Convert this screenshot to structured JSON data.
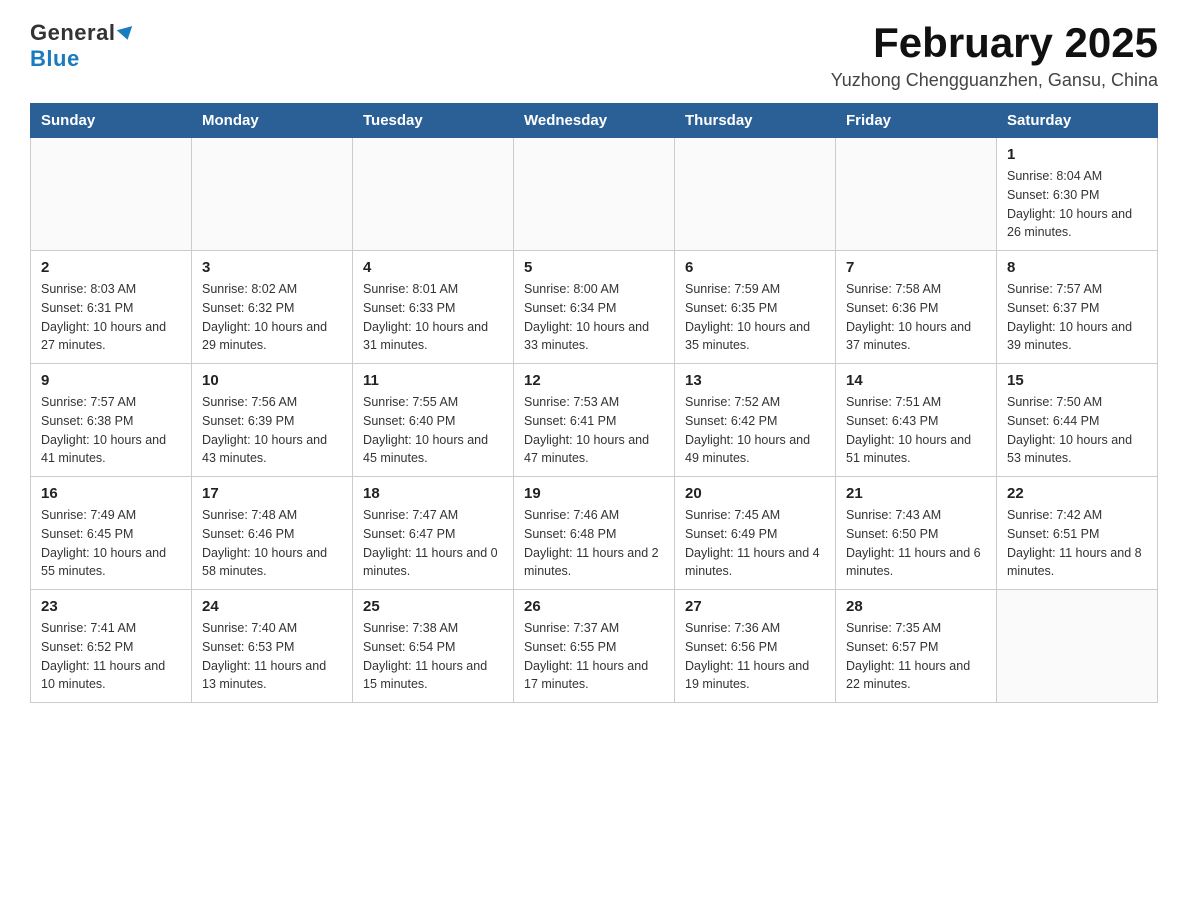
{
  "header": {
    "logo_general": "General",
    "logo_blue": "Blue",
    "month_title": "February 2025",
    "location": "Yuzhong Chengguanzhen, Gansu, China"
  },
  "weekdays": [
    "Sunday",
    "Monday",
    "Tuesday",
    "Wednesday",
    "Thursday",
    "Friday",
    "Saturday"
  ],
  "weeks": [
    [
      {
        "day": "",
        "info": ""
      },
      {
        "day": "",
        "info": ""
      },
      {
        "day": "",
        "info": ""
      },
      {
        "day": "",
        "info": ""
      },
      {
        "day": "",
        "info": ""
      },
      {
        "day": "",
        "info": ""
      },
      {
        "day": "1",
        "info": "Sunrise: 8:04 AM\nSunset: 6:30 PM\nDaylight: 10 hours and 26 minutes."
      }
    ],
    [
      {
        "day": "2",
        "info": "Sunrise: 8:03 AM\nSunset: 6:31 PM\nDaylight: 10 hours and 27 minutes."
      },
      {
        "day": "3",
        "info": "Sunrise: 8:02 AM\nSunset: 6:32 PM\nDaylight: 10 hours and 29 minutes."
      },
      {
        "day": "4",
        "info": "Sunrise: 8:01 AM\nSunset: 6:33 PM\nDaylight: 10 hours and 31 minutes."
      },
      {
        "day": "5",
        "info": "Sunrise: 8:00 AM\nSunset: 6:34 PM\nDaylight: 10 hours and 33 minutes."
      },
      {
        "day": "6",
        "info": "Sunrise: 7:59 AM\nSunset: 6:35 PM\nDaylight: 10 hours and 35 minutes."
      },
      {
        "day": "7",
        "info": "Sunrise: 7:58 AM\nSunset: 6:36 PM\nDaylight: 10 hours and 37 minutes."
      },
      {
        "day": "8",
        "info": "Sunrise: 7:57 AM\nSunset: 6:37 PM\nDaylight: 10 hours and 39 minutes."
      }
    ],
    [
      {
        "day": "9",
        "info": "Sunrise: 7:57 AM\nSunset: 6:38 PM\nDaylight: 10 hours and 41 minutes."
      },
      {
        "day": "10",
        "info": "Sunrise: 7:56 AM\nSunset: 6:39 PM\nDaylight: 10 hours and 43 minutes."
      },
      {
        "day": "11",
        "info": "Sunrise: 7:55 AM\nSunset: 6:40 PM\nDaylight: 10 hours and 45 minutes."
      },
      {
        "day": "12",
        "info": "Sunrise: 7:53 AM\nSunset: 6:41 PM\nDaylight: 10 hours and 47 minutes."
      },
      {
        "day": "13",
        "info": "Sunrise: 7:52 AM\nSunset: 6:42 PM\nDaylight: 10 hours and 49 minutes."
      },
      {
        "day": "14",
        "info": "Sunrise: 7:51 AM\nSunset: 6:43 PM\nDaylight: 10 hours and 51 minutes."
      },
      {
        "day": "15",
        "info": "Sunrise: 7:50 AM\nSunset: 6:44 PM\nDaylight: 10 hours and 53 minutes."
      }
    ],
    [
      {
        "day": "16",
        "info": "Sunrise: 7:49 AM\nSunset: 6:45 PM\nDaylight: 10 hours and 55 minutes."
      },
      {
        "day": "17",
        "info": "Sunrise: 7:48 AM\nSunset: 6:46 PM\nDaylight: 10 hours and 58 minutes."
      },
      {
        "day": "18",
        "info": "Sunrise: 7:47 AM\nSunset: 6:47 PM\nDaylight: 11 hours and 0 minutes."
      },
      {
        "day": "19",
        "info": "Sunrise: 7:46 AM\nSunset: 6:48 PM\nDaylight: 11 hours and 2 minutes."
      },
      {
        "day": "20",
        "info": "Sunrise: 7:45 AM\nSunset: 6:49 PM\nDaylight: 11 hours and 4 minutes."
      },
      {
        "day": "21",
        "info": "Sunrise: 7:43 AM\nSunset: 6:50 PM\nDaylight: 11 hours and 6 minutes."
      },
      {
        "day": "22",
        "info": "Sunrise: 7:42 AM\nSunset: 6:51 PM\nDaylight: 11 hours and 8 minutes."
      }
    ],
    [
      {
        "day": "23",
        "info": "Sunrise: 7:41 AM\nSunset: 6:52 PM\nDaylight: 11 hours and 10 minutes."
      },
      {
        "day": "24",
        "info": "Sunrise: 7:40 AM\nSunset: 6:53 PM\nDaylight: 11 hours and 13 minutes."
      },
      {
        "day": "25",
        "info": "Sunrise: 7:38 AM\nSunset: 6:54 PM\nDaylight: 11 hours and 15 minutes."
      },
      {
        "day": "26",
        "info": "Sunrise: 7:37 AM\nSunset: 6:55 PM\nDaylight: 11 hours and 17 minutes."
      },
      {
        "day": "27",
        "info": "Sunrise: 7:36 AM\nSunset: 6:56 PM\nDaylight: 11 hours and 19 minutes."
      },
      {
        "day": "28",
        "info": "Sunrise: 7:35 AM\nSunset: 6:57 PM\nDaylight: 11 hours and 22 minutes."
      },
      {
        "day": "",
        "info": ""
      }
    ]
  ]
}
